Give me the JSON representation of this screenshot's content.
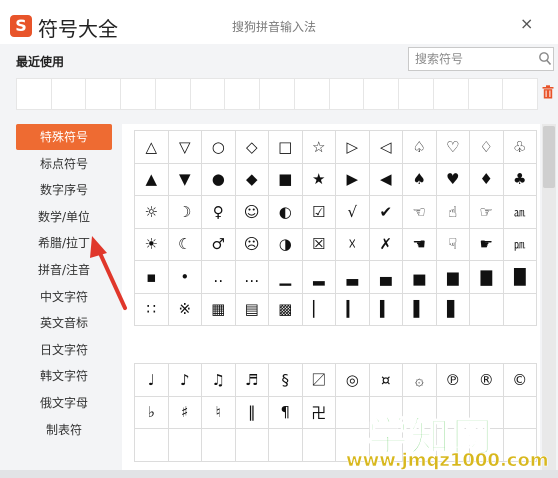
{
  "window": {
    "logo_letter": "S",
    "title": "符号大全",
    "subtitle": "搜狗拼音输入法",
    "close_glyph": "×"
  },
  "recent": {
    "label": "最近使用",
    "slots": 15
  },
  "search": {
    "placeholder": "搜索符号",
    "value": ""
  },
  "categories": [
    {
      "label": "特殊符号",
      "active": true
    },
    {
      "label": "标点符号",
      "active": false
    },
    {
      "label": "数字序号",
      "active": false
    },
    {
      "label": "数学/单位",
      "active": false
    },
    {
      "label": "希腊/拉丁",
      "active": false
    },
    {
      "label": "拼音/注音",
      "active": false
    },
    {
      "label": "中文字符",
      "active": false
    },
    {
      "label": "英文音标",
      "active": false
    },
    {
      "label": "日文字符",
      "active": false
    },
    {
      "label": "韩文字符",
      "active": false
    },
    {
      "label": "俄文字母",
      "active": false
    },
    {
      "label": "制表符",
      "active": false
    }
  ],
  "symbols_group1": [
    [
      "△",
      "▽",
      "○",
      "◇",
      "□",
      "☆",
      "▷",
      "◁",
      "♤",
      "♡",
      "♢",
      "♧"
    ],
    [
      "▲",
      "▼",
      "●",
      "◆",
      "■",
      "★",
      "▶",
      "◀",
      "♠",
      "♥",
      "♦",
      "♣"
    ],
    [
      "☼",
      "☽",
      "♀",
      "☺",
      "◐",
      "☑",
      "√",
      "✔",
      "☜",
      "☝",
      "☞",
      "㏂"
    ],
    [
      "☀",
      "☾",
      "♂",
      "☹",
      "◑",
      "☒",
      "☓",
      "✗",
      "☚",
      "☟",
      "☛",
      "㏘"
    ],
    [
      "▪",
      "•",
      "‥",
      "…",
      "▁",
      "▂",
      "▃",
      "▄",
      "▅",
      "▆",
      "▇",
      "█"
    ],
    [
      "∷",
      "※",
      "▦",
      "▤",
      "▩",
      "▏",
      "▎",
      "▍",
      "▌",
      "▋",
      "",
      ""
    ]
  ],
  "symbols_group2": [
    [
      "♩",
      "♪",
      "♫",
      "♬",
      "§",
      "〼",
      "◎",
      "¤",
      "۞",
      "℗",
      "®",
      "©"
    ],
    [
      "♭",
      "♯",
      "♮",
      "‖",
      "¶",
      "卍",
      "",
      "",
      "",
      "",
      "",
      ""
    ],
    [
      "",
      "",
      "",
      "",
      "",
      "",
      "",
      "",
      "",
      "",
      "",
      ""
    ]
  ],
  "watermark": {
    "text": "学知网",
    "url": "www.jmqz1000.com"
  },
  "colors": {
    "accent": "#ee6b32",
    "watermark_green": "#3cbe3c",
    "watermark_gold": "#d8b81e"
  }
}
